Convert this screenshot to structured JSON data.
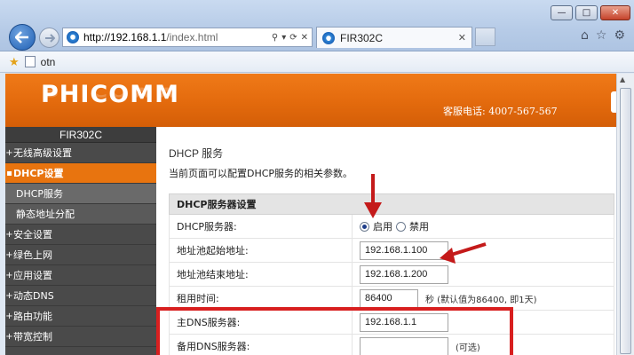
{
  "browser": {
    "url_host": "http://192.168.1.1",
    "url_path": "/index.html",
    "tab_title": "FIR302C",
    "favorite_item": "otn",
    "window_controls": {
      "minimize": "—",
      "maximize": "□",
      "close": "✕"
    },
    "icons": [
      "back-icon",
      "forward-icon",
      "ie-icon",
      "search-icon",
      "compat-icon",
      "refresh-icon",
      "stop-icon",
      "home-icon",
      "star-icon",
      "gear-icon"
    ]
  },
  "page": {
    "logo": "PHICOMM",
    "hotline": "客服电话: 4007-567-567",
    "model": "FIR302C",
    "sidebar": {
      "items": [
        {
          "label": "无线高级设置",
          "type": "top"
        },
        {
          "label": "DHCP设置",
          "type": "active"
        },
        {
          "label": "DHCP服务",
          "type": "sub-current"
        },
        {
          "label": "静态地址分配",
          "type": "sub"
        },
        {
          "label": "安全设置",
          "type": "top"
        },
        {
          "label": "绿色上网",
          "type": "top"
        },
        {
          "label": "应用设置",
          "type": "top"
        },
        {
          "label": "动态DNS",
          "type": "top"
        },
        {
          "label": "路由功能",
          "type": "top"
        },
        {
          "label": "带宽控制",
          "type": "top"
        }
      ]
    },
    "main": {
      "title": "DHCP 服务",
      "description": "当前页面可以配置DHCP服务的相关参数。",
      "panel_title": "DHCP服务器设置",
      "rows": {
        "dhcp_server": {
          "label": "DHCP服务器:",
          "enable": "启用",
          "disable": "禁用",
          "selected": "启用"
        },
        "start_ip": {
          "label": "地址池起始地址:",
          "value": "192.168.1.100"
        },
        "end_ip": {
          "label": "地址池结束地址:",
          "value": "192.168.1.200"
        },
        "lease": {
          "label": "租用时间:",
          "value": "86400",
          "note": "秒 (默认值为86400, 即1天)"
        },
        "primary_dns": {
          "label": "主DNS服务器:",
          "value": "192.168.1.1"
        },
        "backup_dns": {
          "label": "备用DNS服务器:",
          "value": "",
          "note": "(可选)"
        }
      }
    }
  },
  "annotation_color": "#d81f1f"
}
